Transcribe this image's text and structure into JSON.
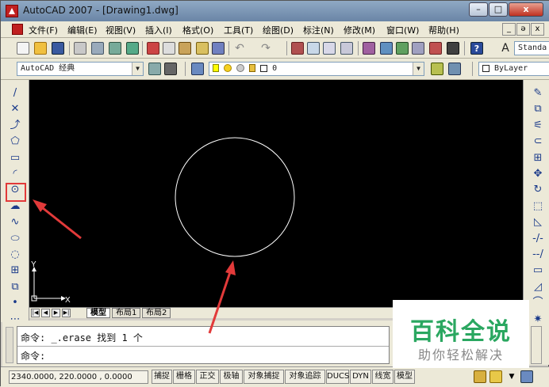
{
  "window": {
    "title": "AutoCAD 2007 - [Drawing1.dwg]",
    "min_label": "–",
    "max_label": "□",
    "close_label": "x",
    "icon": "autocad-logo-icon"
  },
  "menubar": {
    "items": [
      "文件(F)",
      "编辑(E)",
      "视图(V)",
      "插入(I)",
      "格式(O)",
      "工具(T)",
      "绘图(D)",
      "标注(N)",
      "修改(M)",
      "窗口(W)",
      "帮助(H)"
    ],
    "doc_min": "_",
    "doc_restore": "ə",
    "doc_close": "x"
  },
  "toolbar": {
    "workspace": "AutoCAD 经典",
    "layer": "0",
    "text_style": "Standa",
    "linetype": "ByLayer"
  },
  "left_tools": [
    {
      "name": "line",
      "glyph": "/"
    },
    {
      "name": "construction-line",
      "glyph": "✕"
    },
    {
      "name": "polyline",
      "glyph": "⤴"
    },
    {
      "name": "polygon",
      "glyph": "⬠"
    },
    {
      "name": "rectangle",
      "glyph": "▭"
    },
    {
      "name": "arc",
      "glyph": "◜"
    },
    {
      "name": "circle",
      "glyph": "⊙"
    },
    {
      "name": "revision-cloud",
      "glyph": "☁"
    },
    {
      "name": "spline",
      "glyph": "∿"
    },
    {
      "name": "ellipse",
      "glyph": "⬭"
    },
    {
      "name": "ellipse-arc",
      "glyph": "◌"
    },
    {
      "name": "insert-block",
      "glyph": "⊞"
    },
    {
      "name": "make-block",
      "glyph": "⧉"
    },
    {
      "name": "point",
      "glyph": "•"
    },
    {
      "name": "hatch",
      "glyph": "⋯"
    }
  ],
  "right_tools": [
    {
      "name": "erase",
      "glyph": "✎"
    },
    {
      "name": "copy",
      "glyph": "⧉"
    },
    {
      "name": "mirror",
      "glyph": "⚟"
    },
    {
      "name": "offset",
      "glyph": "⊂"
    },
    {
      "name": "array",
      "glyph": "⊞"
    },
    {
      "name": "move",
      "glyph": "✥"
    },
    {
      "name": "rotate",
      "glyph": "↻"
    },
    {
      "name": "scale",
      "glyph": "⬚"
    },
    {
      "name": "stretch",
      "glyph": "◺"
    },
    {
      "name": "trim",
      "glyph": "-/-"
    },
    {
      "name": "extend",
      "glyph": "--/"
    },
    {
      "name": "break",
      "glyph": "▭"
    },
    {
      "name": "chamfer",
      "glyph": "◿"
    },
    {
      "name": "fillet",
      "glyph": "⌒"
    },
    {
      "name": "explode",
      "glyph": "✷"
    }
  ],
  "canvas": {
    "ucs_x": "X",
    "ucs_y": "Y"
  },
  "tabs": [
    "模型",
    "布局1",
    "布局2"
  ],
  "command": {
    "line1": "命令: _.erase 找到 1 个",
    "line2": "命令:"
  },
  "status": {
    "coords": "2340.0000, 220.0000 , 0.0000",
    "toggles": [
      "捕捉",
      "栅格",
      "正交",
      "极轴",
      "对象捕捉",
      "对象追踪",
      "DUCS",
      "DYN",
      "线宽",
      "模型"
    ]
  },
  "watermark": {
    "main": "百科全说",
    "sub": "助你轻松解决"
  },
  "colors": {
    "canvas": "#000000",
    "annotation_red": "#e23a3a",
    "watermark_green": "#2aa760"
  }
}
